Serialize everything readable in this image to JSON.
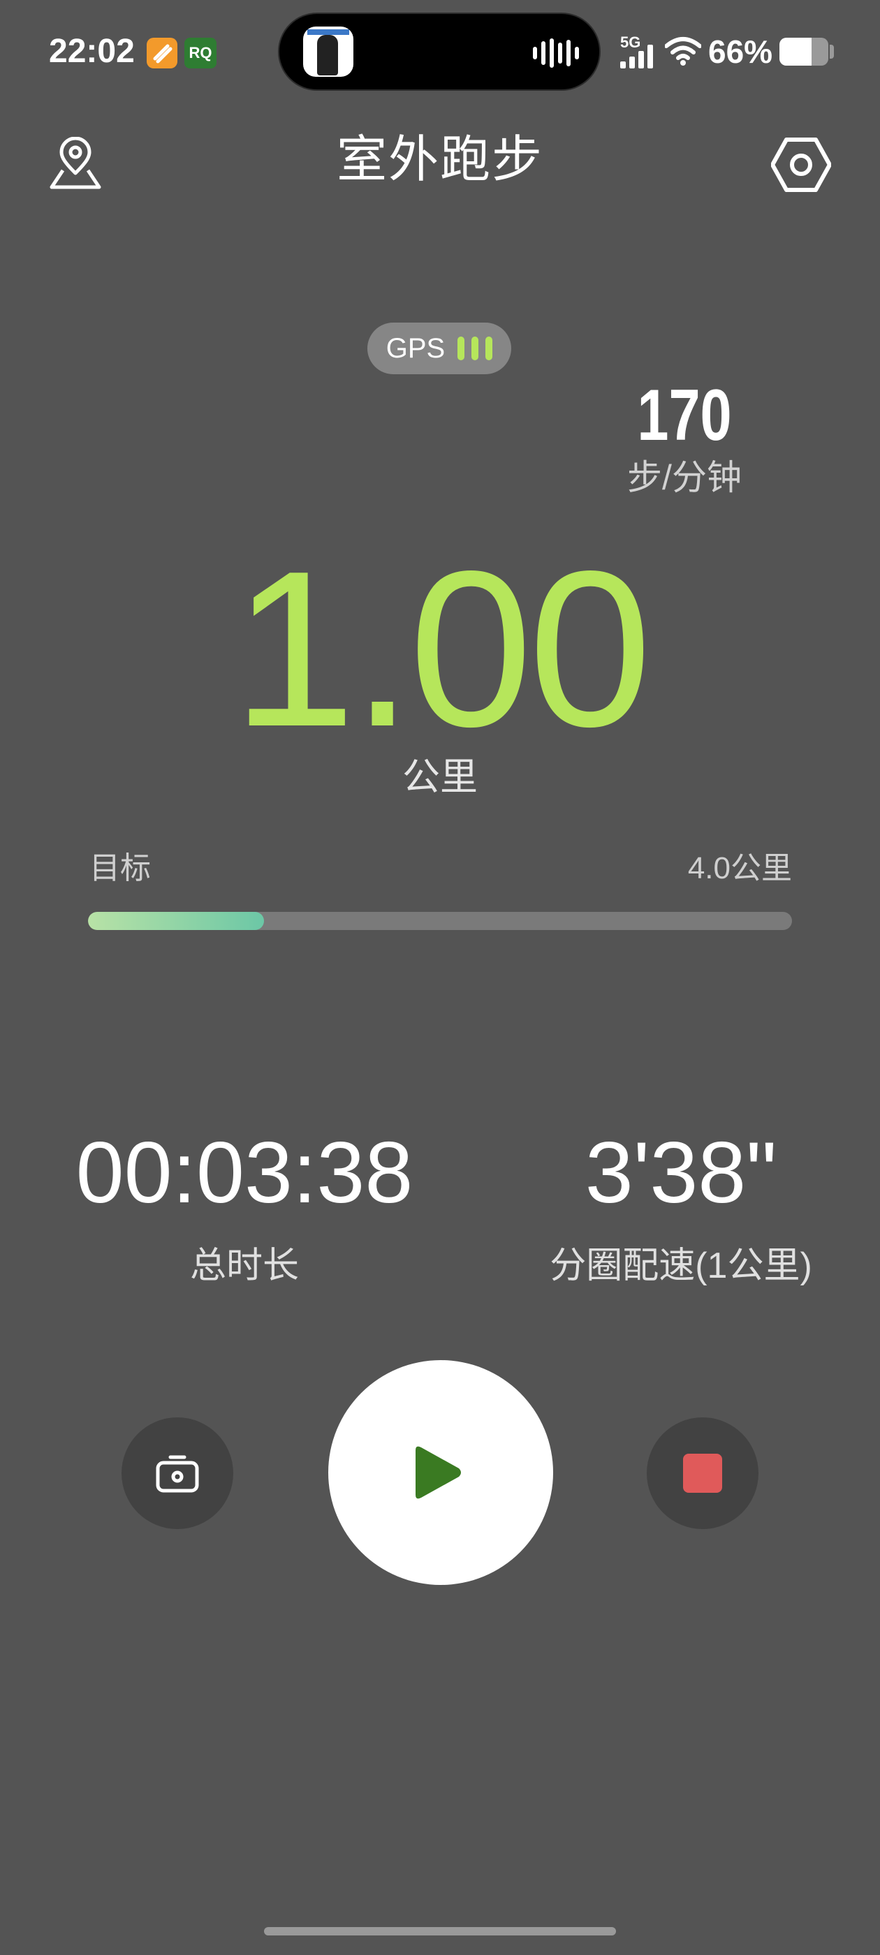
{
  "status_bar": {
    "time": "22:02",
    "app_badge": "RQ",
    "signal_label": "5G",
    "battery_percent": "66%",
    "battery_level": 0.66
  },
  "header": {
    "title": "室外跑步",
    "left_icon": "location-pin-icon",
    "right_icon": "settings-hex-icon"
  },
  "gps": {
    "label": "GPS",
    "signal_bars": 3
  },
  "cadence": {
    "value": "170",
    "unit": "步/分钟"
  },
  "distance": {
    "value": "1.00",
    "unit": "公里"
  },
  "goal": {
    "label": "目标",
    "value": "4.0公里",
    "progress": 0.25
  },
  "stats": {
    "duration": {
      "value": "00:03:38",
      "label": "总时长"
    },
    "lap_pace": {
      "value": "3'38\"",
      "label": "分圈配速(1公里)"
    }
  },
  "controls": {
    "camera_icon": "camera-icon",
    "play_icon": "play-icon",
    "stop_icon": "stop-icon"
  },
  "colors": {
    "background": "#545454",
    "accent": "#b6e65b",
    "play": "#3a7a22",
    "stop": "#e05a5a"
  }
}
